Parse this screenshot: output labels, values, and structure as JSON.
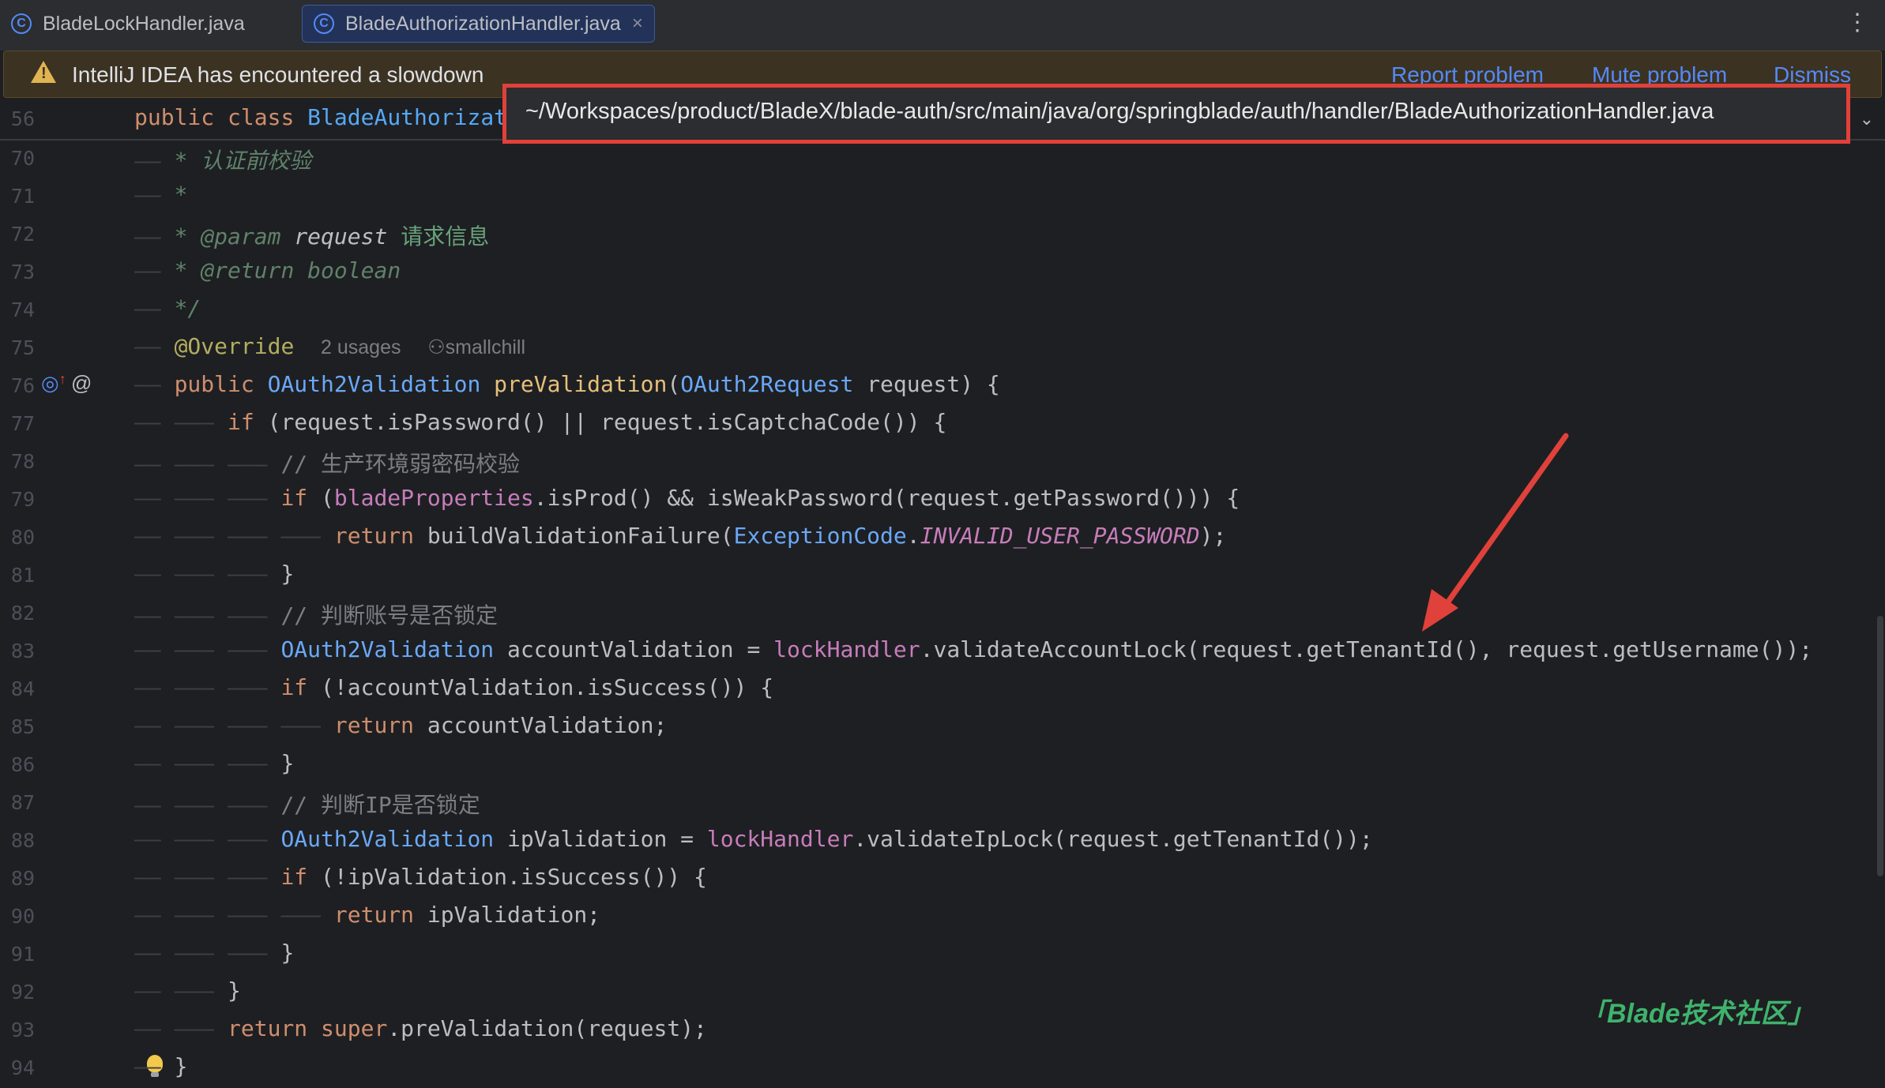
{
  "tabs": [
    {
      "label": "BladeLockHandler.java",
      "active": false
    },
    {
      "label": "BladeAuthorizationHandler.java",
      "active": true
    }
  ],
  "notification": {
    "message": "IntelliJ IDEA has encountered a slowdown",
    "links": [
      "Report problem",
      "Mute problem",
      "Dismiss"
    ]
  },
  "path_popup": "~/Workspaces/product/BladeX/blade-auth/src/main/java/org/springblade/auth/handler/BladeAuthorizationHandler.java",
  "sticky": {
    "line": "56",
    "text_kw1": "public",
    "text_kw2": "class",
    "text_name": "BladeAuthorizat"
  },
  "lines": [
    "70",
    "71",
    "72",
    "73",
    "74",
    "75",
    "76",
    "77",
    "78",
    "79",
    "80",
    "81",
    "82",
    "83",
    "84",
    "85",
    "86",
    "87",
    "88",
    "89",
    "90",
    "91",
    "92",
    "93",
    "94"
  ],
  "code": {
    "l70": "* 认证前校验",
    "l71": "*",
    "l72_star": "*",
    "l72_tag": "@param",
    "l72_name": "request",
    "l72_desc": "请求信息",
    "l73_star": "*",
    "l73_tag": "@return",
    "l73_desc": "boolean",
    "l74": "*/",
    "l75_ann": "@Override",
    "l75_usages": "2 usages",
    "l75_author": "smallchill",
    "l76_kw": "public",
    "l76_type": "OAuth2Validation",
    "l76_name": "preValidation",
    "l76_p1": "(",
    "l76_ptype": "OAuth2Request",
    "l76_rest": " request) {",
    "l77_kw": "if",
    "l77_rest": " (request.isPassword() || request.isCaptchaCode()) {",
    "l78": "// 生产环境弱密码校验",
    "l79_kw": "if",
    "l79_a": " (",
    "l79_fld": "bladeProperties",
    "l79_rest": ".isProd() && isWeakPassword(request.getPassword())) {",
    "l80_kw": "return",
    "l80_a": " buildValidationFailure(",
    "l80_type": "ExceptionCode",
    "l80_dot": ".",
    "l80_const": "INVALID_USER_PASSWORD",
    "l80_end": ");",
    "l81": "}",
    "l82": "// 判断账号是否锁定",
    "l83_type": "OAuth2Validation",
    "l83_a": " accountValidation = ",
    "l83_fld": "lockHandler",
    "l83_rest": ".validateAccountLock(request.getTenantId(), request.getUsername());",
    "l84_kw": "if",
    "l84_rest": " (!accountValidation.isSuccess()) {",
    "l85_kw": "return",
    "l85_rest": " accountValidation;",
    "l86": "}",
    "l87": "// 判断IP是否锁定",
    "l88_type": "OAuth2Validation",
    "l88_a": " ipValidation = ",
    "l88_fld": "lockHandler",
    "l88_rest": ".validateIpLock(request.getTenantId());",
    "l89_kw": "if",
    "l89_rest": " (!ipValidation.isSuccess()) {",
    "l90_kw": "return",
    "l90_rest": " ipValidation;",
    "l91": "}",
    "l92": "}",
    "l93_kw": "return",
    "l93_sup": " super",
    "l93_rest": ".preValidation(request);",
    "l94": "}"
  },
  "watermark": "「Blade技术社区」",
  "colors": {
    "annotation_box": "#e0413a",
    "arrow": "#e0413a",
    "watermark": "#3fb36c"
  }
}
